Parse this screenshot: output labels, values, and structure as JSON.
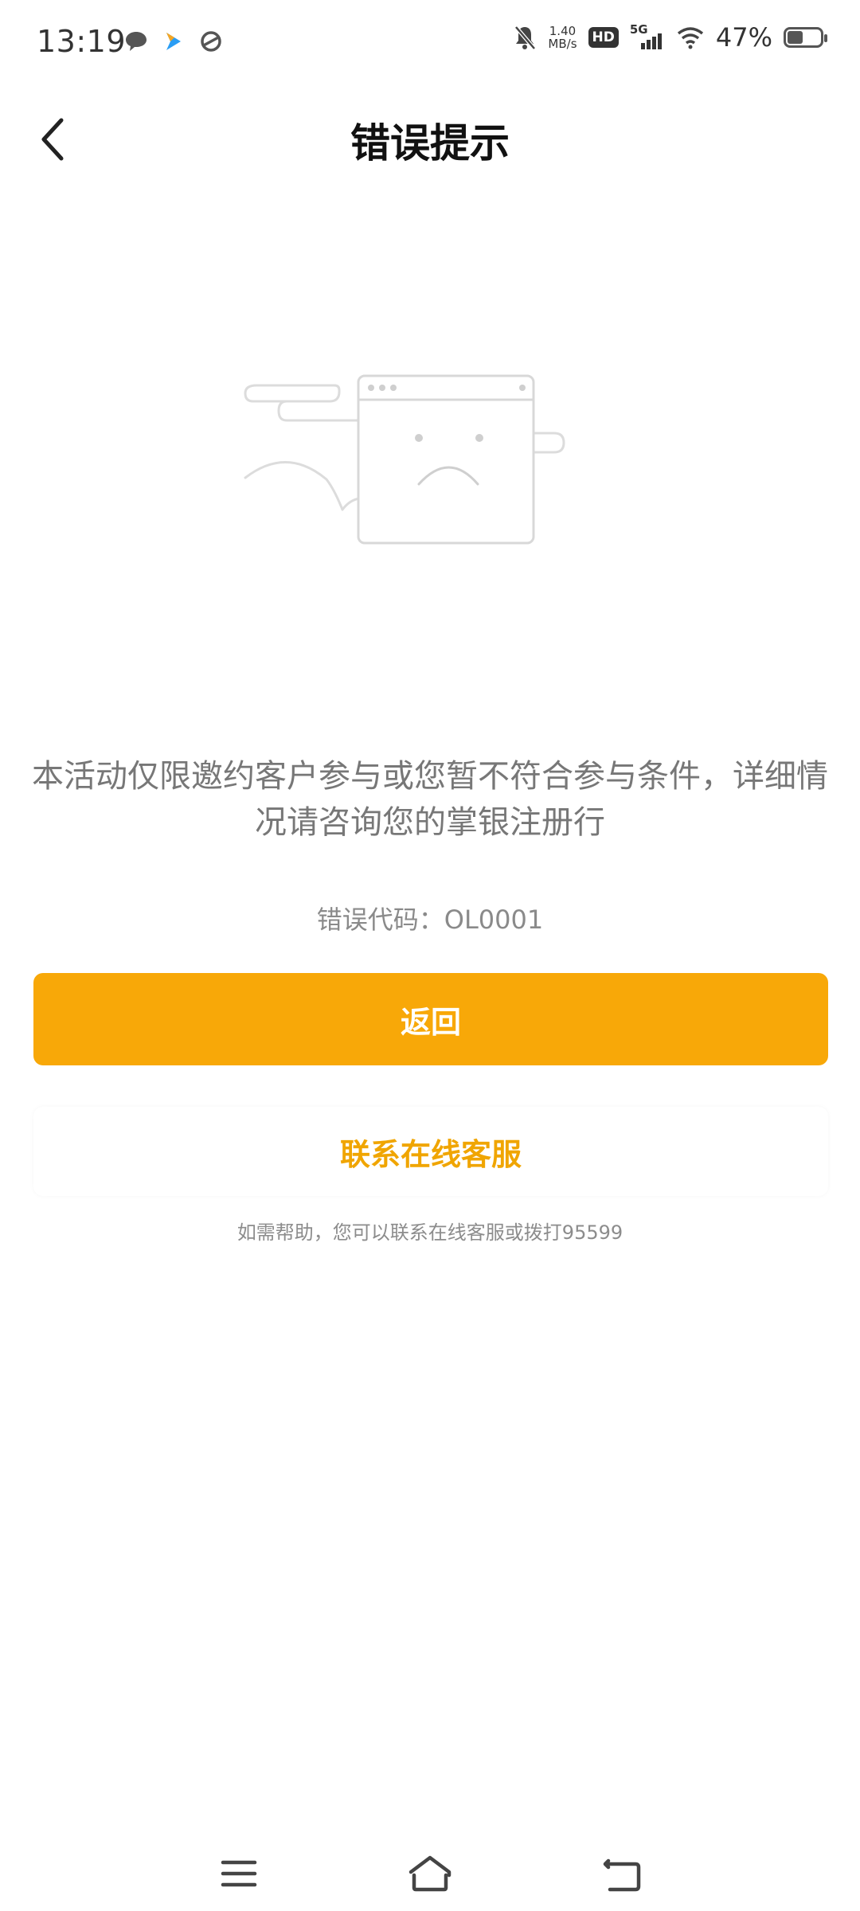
{
  "status_bar": {
    "time": "13:19",
    "net_speed_value": "1.40",
    "net_speed_unit": "MB/s",
    "hd": "HD",
    "network": "5G",
    "battery_percent": "47%",
    "battery_level": 0.47
  },
  "header": {
    "title": "错误提示"
  },
  "content": {
    "message": "本活动仅限邀约客户参与或您暂不符合参与条件，详细情况请咨询您的掌银注册行",
    "error_code": "错误代码：OL0001",
    "primary_button": "返回",
    "secondary_button": "联系在线客服",
    "help_text": "如需帮助，您可以联系在线客服或拨打95599"
  },
  "colors": {
    "accent": "#f8a808",
    "secondary_text": "#f0a500"
  }
}
